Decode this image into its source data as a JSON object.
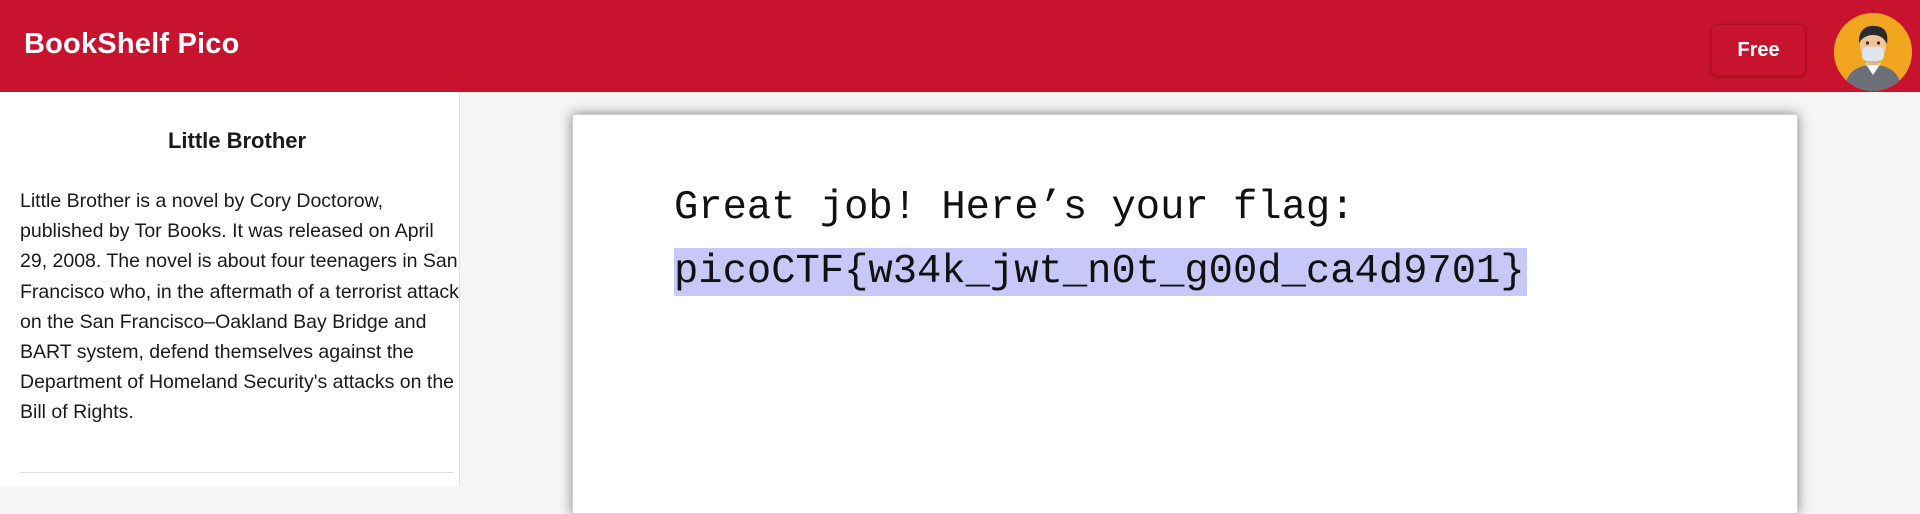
{
  "header": {
    "app_title": "BookShelf Pico",
    "plan_button_label": "Free",
    "brand_color": "#c8132f"
  },
  "sidebar": {
    "book_title": "Little Brother",
    "book_description": "Little Brother is a novel by Cory Doctorow, published by Tor Books. It was released on April 29, 2008. The novel is about four teenagers in San Francisco who, in the aftermath of a terrorist attack on the San Francisco–Oakland Bay Bridge and BART system, defend themselves against the Department of Homeland Security's attacks on the Bill of Rights."
  },
  "reader": {
    "message": "Great job! Here’s your flag:",
    "flag": "picoCTF{w34k_jwt_n0t_g00d_ca4d9701}",
    "selection_highlight_color": "#c8c8f8"
  },
  "icons": {
    "avatar": "user-avatar-icon"
  }
}
